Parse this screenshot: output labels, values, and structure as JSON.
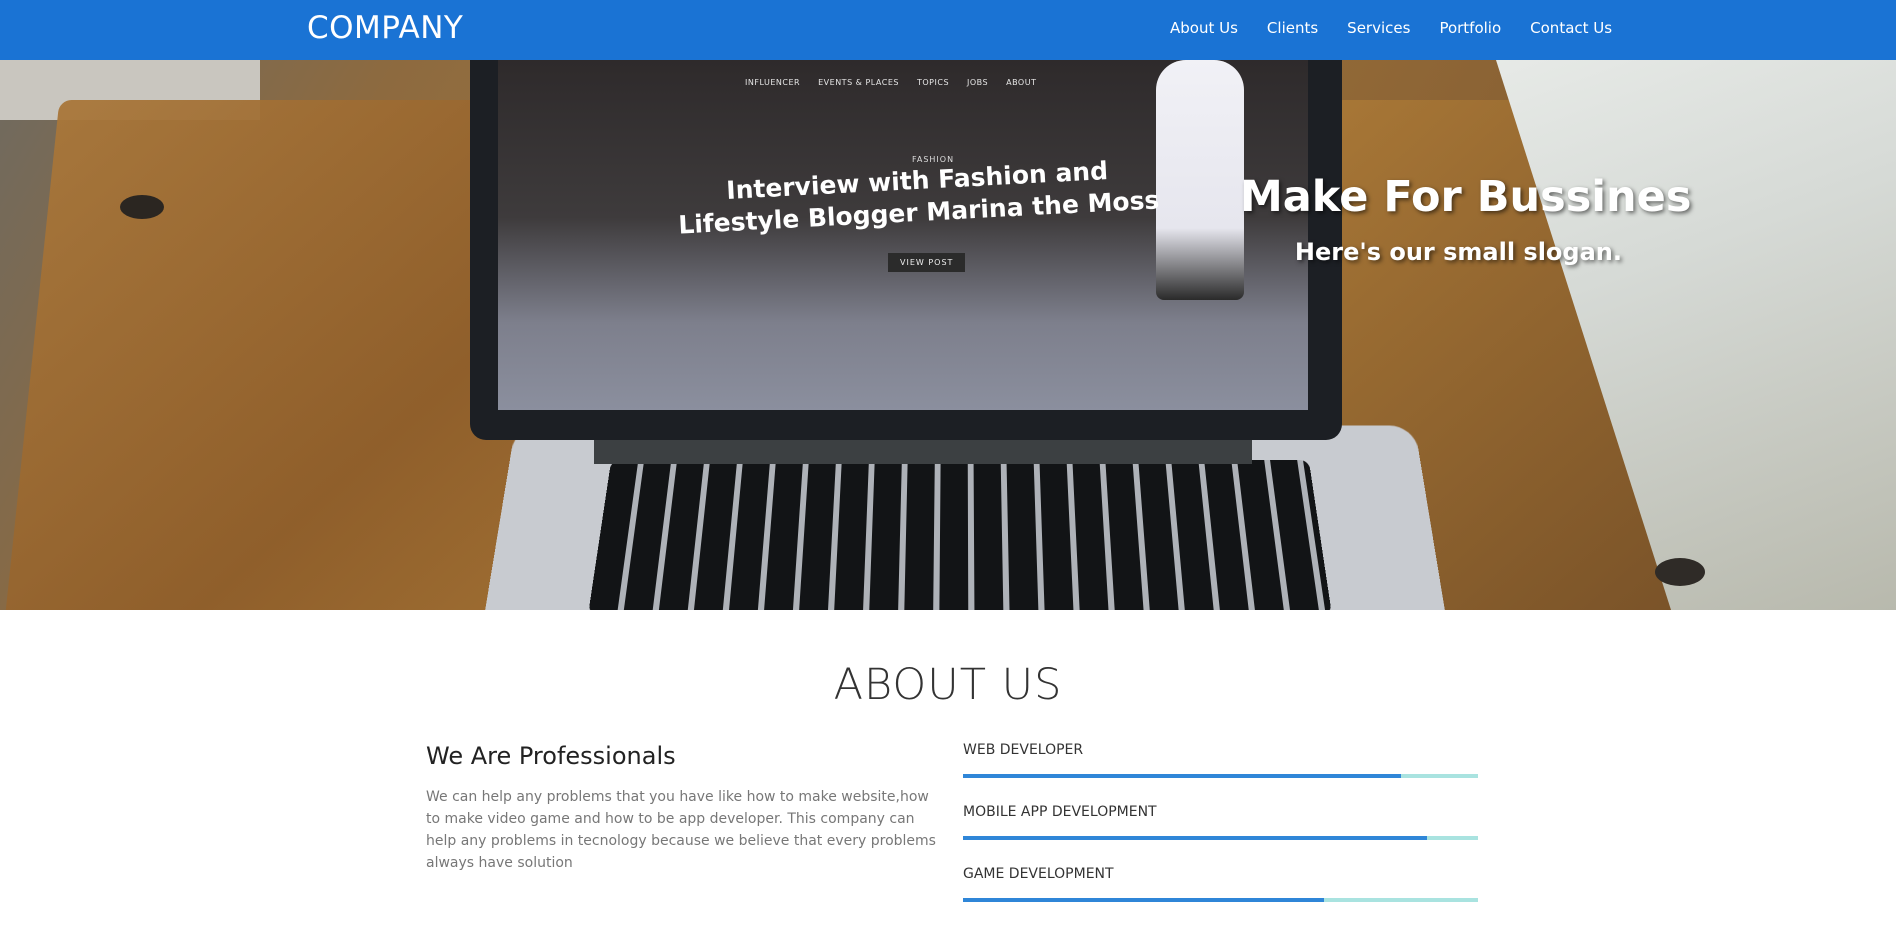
{
  "navbar": {
    "brand": "COMPANY",
    "links": [
      "About Us",
      "Clients",
      "Services",
      "Portfolio",
      "Contact Us"
    ]
  },
  "hero": {
    "title": "Make For Bussines",
    "slogan": "Here's our small slogan.",
    "image": {
      "menu": [
        "INFLUENCER",
        "EVENTS & PLACES",
        "TOPICS",
        "JOBS",
        "ABOUT"
      ],
      "category": "FASHION",
      "headline": "Interview with Fashion and Lifestyle Blogger Marina the Moss",
      "button": "VIEW POST"
    }
  },
  "about": {
    "title": "ABOUT US",
    "subtitle": "We Are Professionals",
    "text": "We can help any problems that you have like how to make website,how to make video game and how to be app developer. This company can help any problems in tecnology because we believe that every problems always have solution"
  },
  "skills": [
    {
      "label": "WEB DEVELOPER",
      "level": 0.85
    },
    {
      "label": "MOBILE APP DEVELOPMENT",
      "level": 0.9
    },
    {
      "label": "GAME DEVELOPMENT",
      "level": 0.7
    }
  ],
  "colors": {
    "navbar": "#1a73d4",
    "skill_fill": "#2f86d8",
    "skill_track": "#a9e3e0"
  }
}
